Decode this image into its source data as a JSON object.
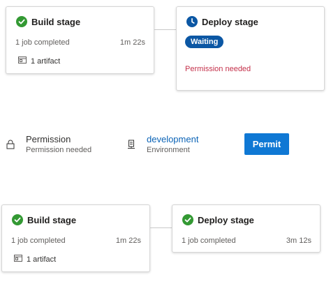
{
  "top_pipeline": {
    "build_stage": {
      "title": "Build stage",
      "jobs_text": "1 job completed",
      "duration": "1m 22s",
      "artifact_text": "1 artifact",
      "status_icon": "check-circle-icon"
    },
    "deploy_stage": {
      "title": "Deploy stage",
      "status_badge": "Waiting",
      "message": "Permission needed",
      "status_icon": "clock-icon"
    }
  },
  "permission_panel": {
    "permission_title": "Permission",
    "permission_subtitle": "Permission needed",
    "environment_name": "development",
    "environment_label": "Environment",
    "permit_button": "Permit"
  },
  "bottom_pipeline": {
    "build_stage": {
      "title": "Build stage",
      "jobs_text": "1 job completed",
      "duration": "1m 22s",
      "artifact_text": "1 artifact",
      "status_icon": "check-circle-icon"
    },
    "deploy_stage": {
      "title": "Deploy stage",
      "jobs_text": "1 job completed",
      "duration": "3m 12s",
      "status_icon": "check-circle-icon"
    }
  },
  "colors": {
    "success": "#339933",
    "waiting": "#0b57a4",
    "error": "#c4314b",
    "primary_button": "#0f78d4",
    "link": "#0b63b6"
  }
}
